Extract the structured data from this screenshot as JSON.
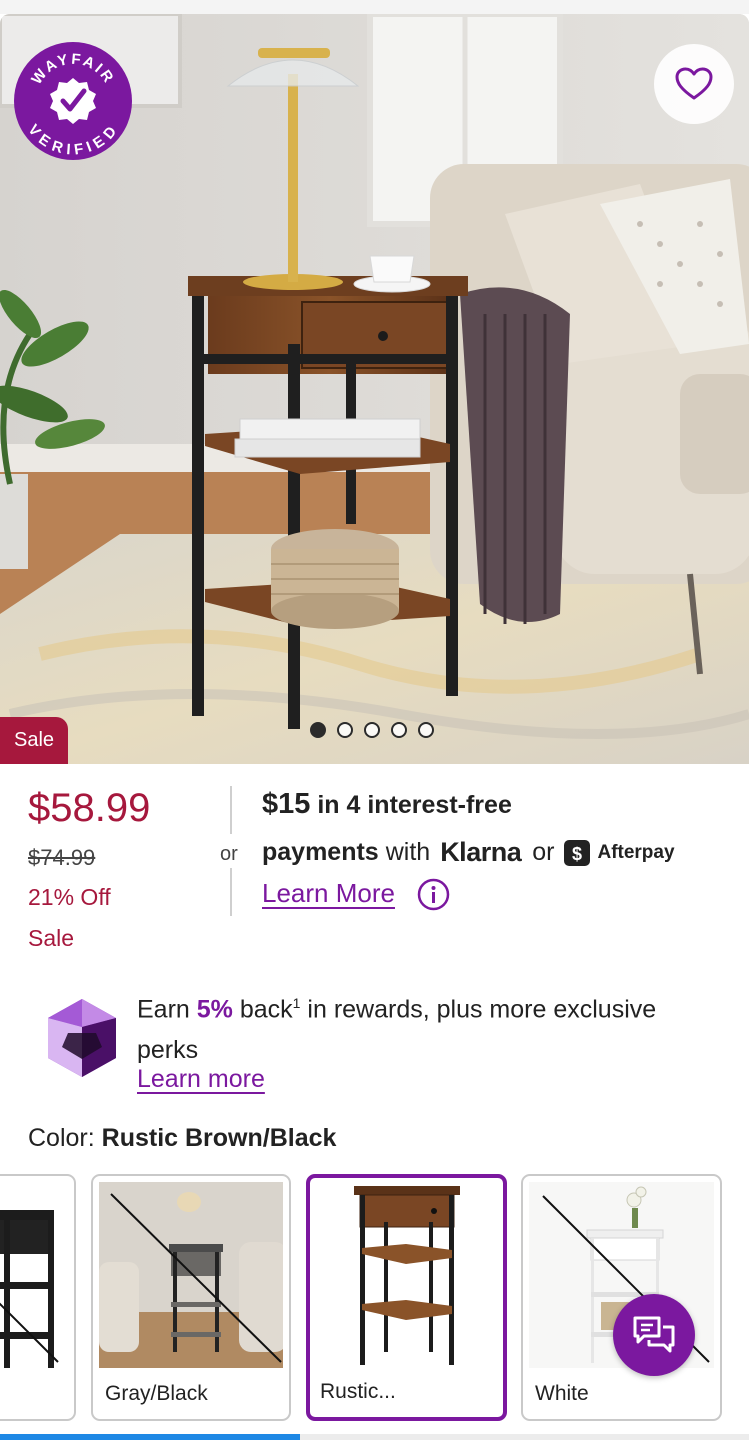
{
  "hero": {
    "badge_top_text": "WAYFAIR",
    "badge_bottom_text": "VERIFIED",
    "sale_tag": "Sale",
    "carousel": {
      "total": 5,
      "active_index": 0
    }
  },
  "pricing": {
    "price": "$58.99",
    "original_price": "$74.99",
    "discount": "21% Off",
    "sale_label": "Sale",
    "or": "or"
  },
  "financing": {
    "amount": "$15",
    "line1_rest": " in 4 interest-free",
    "payments": "payments",
    "with": "with",
    "klarna": "Klarna",
    "or": "or",
    "afterpay": "Afterpay",
    "learn_more": "Learn More"
  },
  "rewards": {
    "earn": "Earn ",
    "percent": "5%",
    "back": " back",
    "footnote": "1",
    "rest": " in rewards, plus more exclusive perks",
    "learn_more": "Learn more"
  },
  "color_selector": {
    "label": "Color: ",
    "selected": "Rustic Brown/Black",
    "options": [
      {
        "label": "",
        "available": false
      },
      {
        "label": "Gray/Black",
        "available": false
      },
      {
        "label": "Rustic...",
        "available": true,
        "selected": true
      },
      {
        "label": "White",
        "available": false
      }
    ]
  },
  "page_progress": 0.4,
  "colors": {
    "brand_purple": "#7b189f",
    "sale_red": "#a6183d"
  }
}
